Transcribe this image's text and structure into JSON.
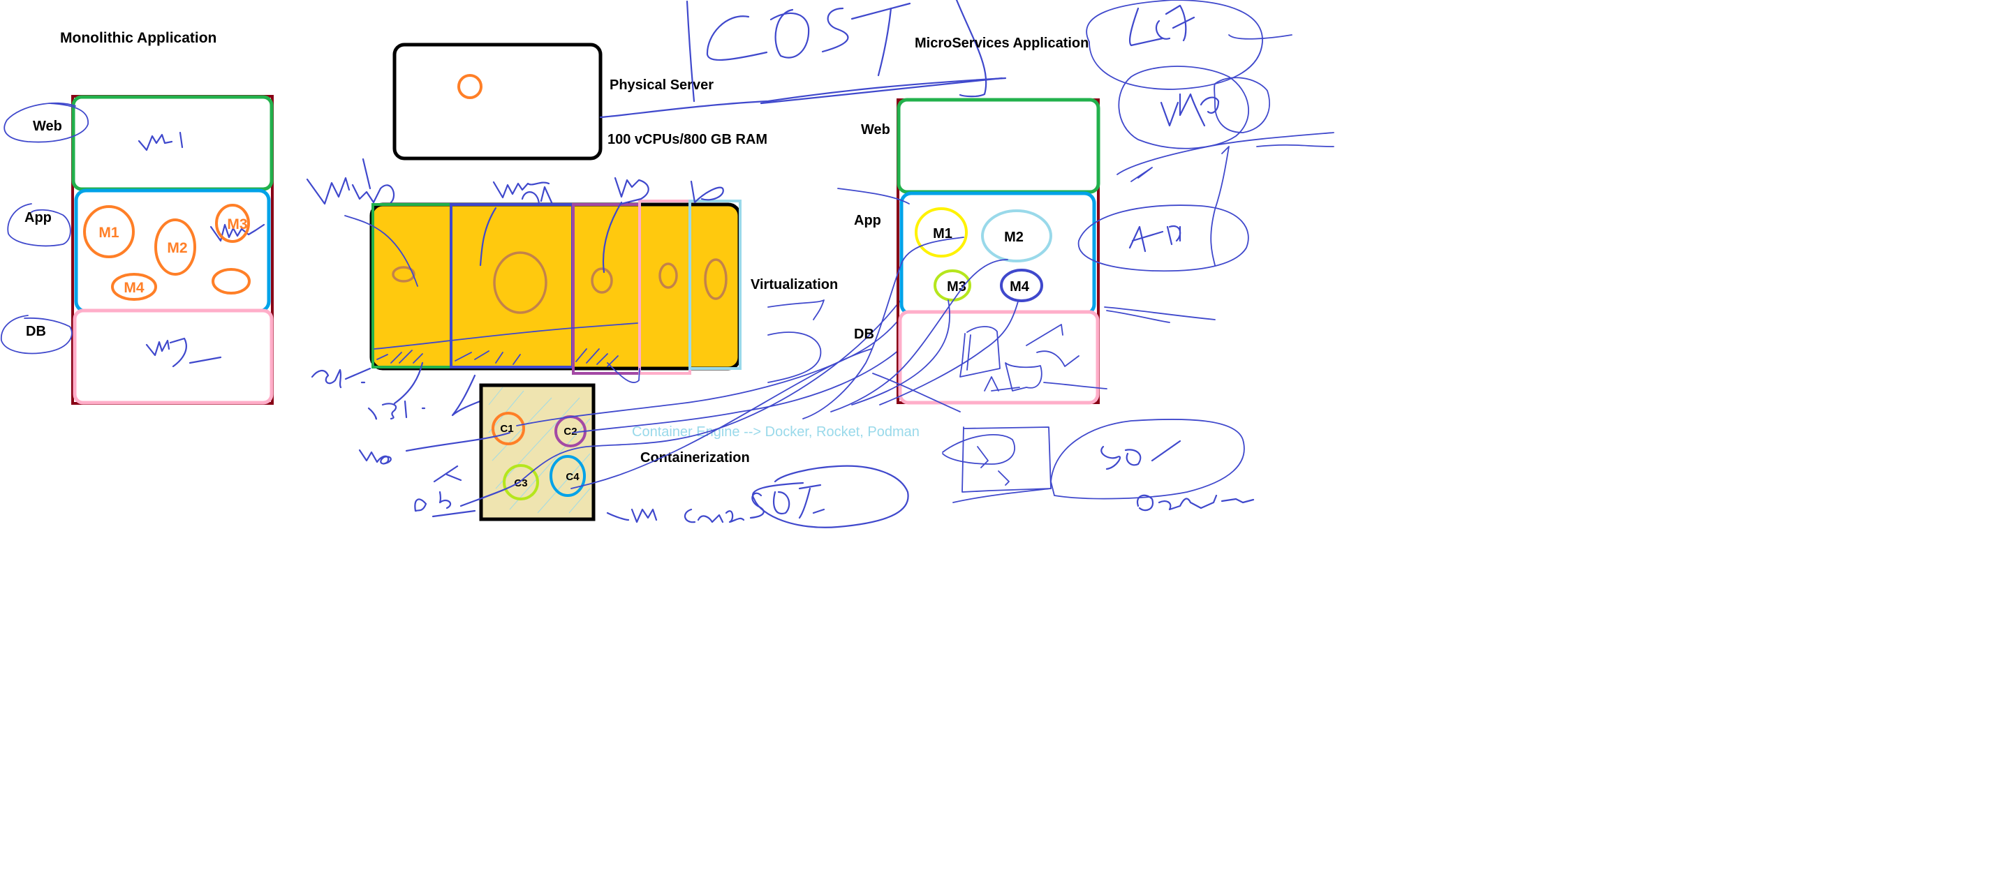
{
  "canvas": {
    "background": "#ffffff"
  },
  "colors": {
    "ink": "#3f48cc",
    "frame_dark_red": "#880015",
    "web_green": "#22b14c",
    "app_blue": "#00a2e8",
    "db_pink": "#ffaec9",
    "module_orange": "#ff7f27",
    "virtualization_fill": "#ffc90e",
    "vm_oval": "#c3824a",
    "vm2_blue": "#3f48cc",
    "vm3_purple": "#a349a4",
    "light_blue": "#99d9ea",
    "container_fill": "#efe4b0",
    "m1_yellow": "#fff200",
    "m3_lime": "#b5e61d",
    "m4_indigo": "#3f48cc",
    "c4_blue": "#00a2e8"
  },
  "monolithic": {
    "title": "Monolithic Application",
    "tiers": [
      {
        "label": "Web",
        "annotation": "VM1"
      },
      {
        "label": "App",
        "annotation": "VM2"
      },
      {
        "label": "DB",
        "annotation": "VM3"
      }
    ],
    "modules": [
      "M1",
      "M2",
      "M3",
      "M4",
      ""
    ]
  },
  "physical_server": {
    "label": "Physical Server",
    "spec": "100 vCPUs/800 GB RAM"
  },
  "virtualization": {
    "label": "Virtualization",
    "vms": [
      {
        "annotation": "VM1 web"
      },
      {
        "annotation": "VM2 app"
      },
      {
        "annotation": "VM3"
      },
      {
        "annotation": ""
      },
      {
        "annotation": "DB"
      }
    ],
    "waste_annotation": "15%",
    "left_annotation": "20%"
  },
  "containerization": {
    "label": "Containerization",
    "engine_note": "Container Engine --> Docker, Rocket, Podman",
    "containers": [
      "C1",
      "C2",
      "C3",
      "C4"
    ],
    "annotations": {
      "web": "web",
      "db": "DB",
      "app": "app",
      "one_vm": "1VM",
      "cost_note": "Cont 50%"
    }
  },
  "microservices": {
    "title": "MicroServices Application",
    "tiers": [
      {
        "label": "Web"
      },
      {
        "label": "App"
      },
      {
        "label": "DB"
      }
    ],
    "modules": [
      "M1",
      "M2",
      "M3",
      "M4"
    ],
    "annotations": {
      "usa": "USA",
      "vm": "VM",
      "api": "API",
      "fifty": "50%",
      "bottom": "Balancing"
    }
  },
  "cost_annotation": "COST"
}
